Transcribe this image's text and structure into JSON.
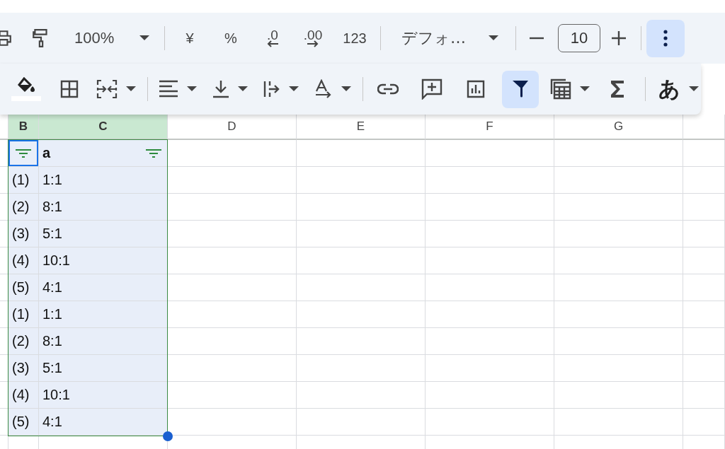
{
  "toolbar": {
    "zoom": "100%",
    "currency": "¥",
    "percent": "%",
    "decrease_decimals": ".0",
    "increase_decimals": ".00",
    "number_format": "123",
    "font": "デフォ…",
    "font_size": "10",
    "more": {
      "selected": true
    }
  },
  "overflow_toolbar": {
    "filter": {
      "selected": true
    },
    "input_tools": "あ"
  },
  "columns": [
    {
      "label": "B",
      "selected": true
    },
    {
      "label": "C",
      "selected": true
    },
    {
      "label": "D",
      "selected": false
    },
    {
      "label": "E",
      "selected": false
    },
    {
      "label": "F",
      "selected": false
    },
    {
      "label": "G",
      "selected": false
    }
  ],
  "filter_row": {
    "column_b": {
      "filter": true,
      "active": true
    },
    "column_c": {
      "text": "a",
      "filter": true,
      "active": false
    }
  },
  "rows": [
    {
      "column_b": "(1)",
      "column_c": "1:1"
    },
    {
      "column_b": "(2)",
      "column_c": "8:1"
    },
    {
      "column_b": "(3)",
      "column_c": "5:1"
    },
    {
      "column_b": "(4)",
      "column_c": "10:1"
    },
    {
      "column_b": "(5)",
      "column_c": "4:1"
    },
    {
      "column_b": "(1)",
      "column_c": "1:1"
    },
    {
      "column_b": "(2)",
      "column_c": "8:1"
    },
    {
      "column_b": "(3)",
      "column_c": "5:1"
    },
    {
      "column_b": "(4)",
      "column_c": "10:1"
    },
    {
      "column_b": "(5)",
      "column_c": "4:1"
    }
  ]
}
